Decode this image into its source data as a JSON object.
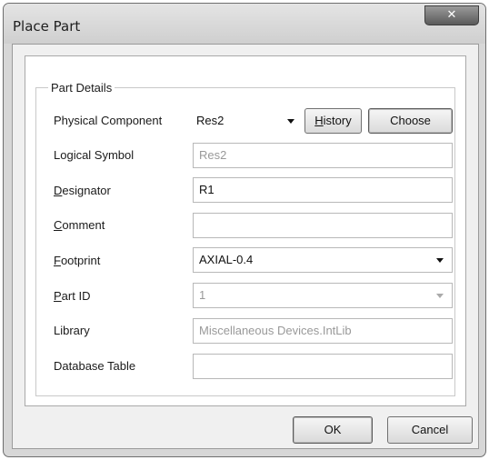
{
  "dialog": {
    "title": "Place Part",
    "close_glyph": "✕"
  },
  "part_details": {
    "group_label": "Part Details",
    "physical_component": {
      "label": "Physical Component",
      "value": "Res2"
    },
    "history_button": {
      "mnemonic": "H",
      "rest": "istory"
    },
    "choose_button": "Choose",
    "logical_symbol": {
      "label": "Logical Symbol",
      "value": "Res2"
    },
    "designator": {
      "label_mnemonic": "D",
      "label_rest": "esignator",
      "value": "R1"
    },
    "comment": {
      "label_mnemonic": "C",
      "label_rest": "omment",
      "value": ""
    },
    "footprint": {
      "label_mnemonic": "F",
      "label_rest": "ootprint",
      "value": "AXIAL-0.4"
    },
    "part_id": {
      "label_mnemonic": "P",
      "label_rest": "art ID",
      "value": "1"
    },
    "library": {
      "label": "Library",
      "value": "Miscellaneous Devices.IntLib"
    },
    "database_table": {
      "label": "Database Table",
      "value": ""
    }
  },
  "buttons": {
    "ok": "OK",
    "cancel": "Cancel"
  },
  "icons": {
    "dropdown": "chevron-down-icon",
    "close": "close-icon"
  }
}
